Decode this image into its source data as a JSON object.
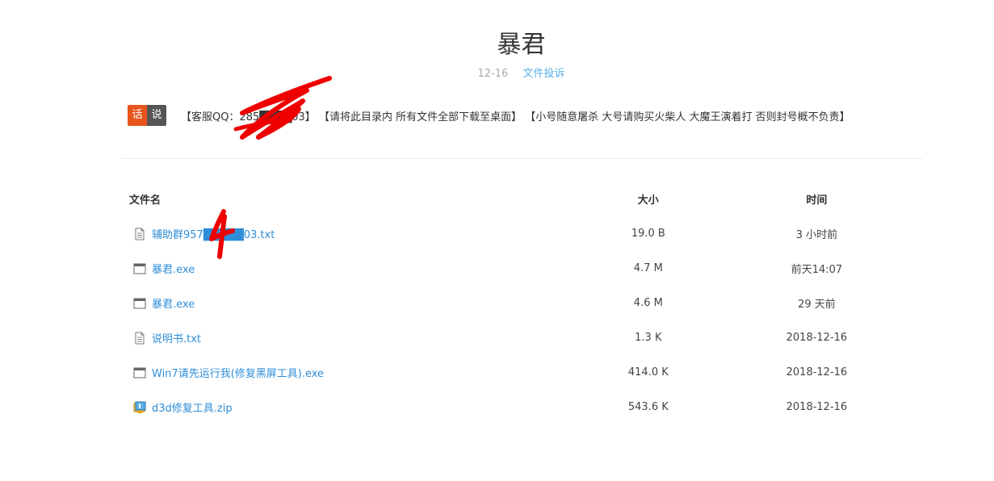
{
  "header": {
    "title": "暴君",
    "date": "12-16",
    "report_link": "文件投诉"
  },
  "notice": {
    "badge_left": "话",
    "badge_right": "说",
    "text": "【客服QQ：285████03】 【请将此目录内 所有文件全部下载至桌面】 【小号随意屠杀 大号请购买火柴人 大魔王演着打 否则封号概不负责】"
  },
  "table": {
    "headers": {
      "name": "文件名",
      "size": "大小",
      "time": "时间"
    },
    "rows": [
      {
        "icon": "text-file-icon",
        "name": "辅助群957█████03.txt",
        "size": "19.0 B",
        "time": "3 小时前"
      },
      {
        "icon": "window-exe-icon",
        "name": "暴君.exe",
        "size": "4.7 M",
        "time": "前天14:07"
      },
      {
        "icon": "window-exe-icon",
        "name": "暴君.exe",
        "size": "4.6 M",
        "time": "29 天前"
      },
      {
        "icon": "text-file-icon",
        "name": "说明书.txt",
        "size": "1.3 K",
        "time": "2018-12-16"
      },
      {
        "icon": "window-exe-icon",
        "name": "Win7请先运行我(修复黑屏工具).exe",
        "size": "414.0 K",
        "time": "2018-12-16"
      },
      {
        "icon": "zip-archive-icon",
        "name": "d3d修复工具.zip",
        "size": "543.6 K",
        "time": "2018-12-16"
      }
    ]
  },
  "colors": {
    "link": "#2f8ed8",
    "badge_orange": "#e8551c",
    "badge_gray": "#555555",
    "scribble_red": "#ee0000"
  }
}
